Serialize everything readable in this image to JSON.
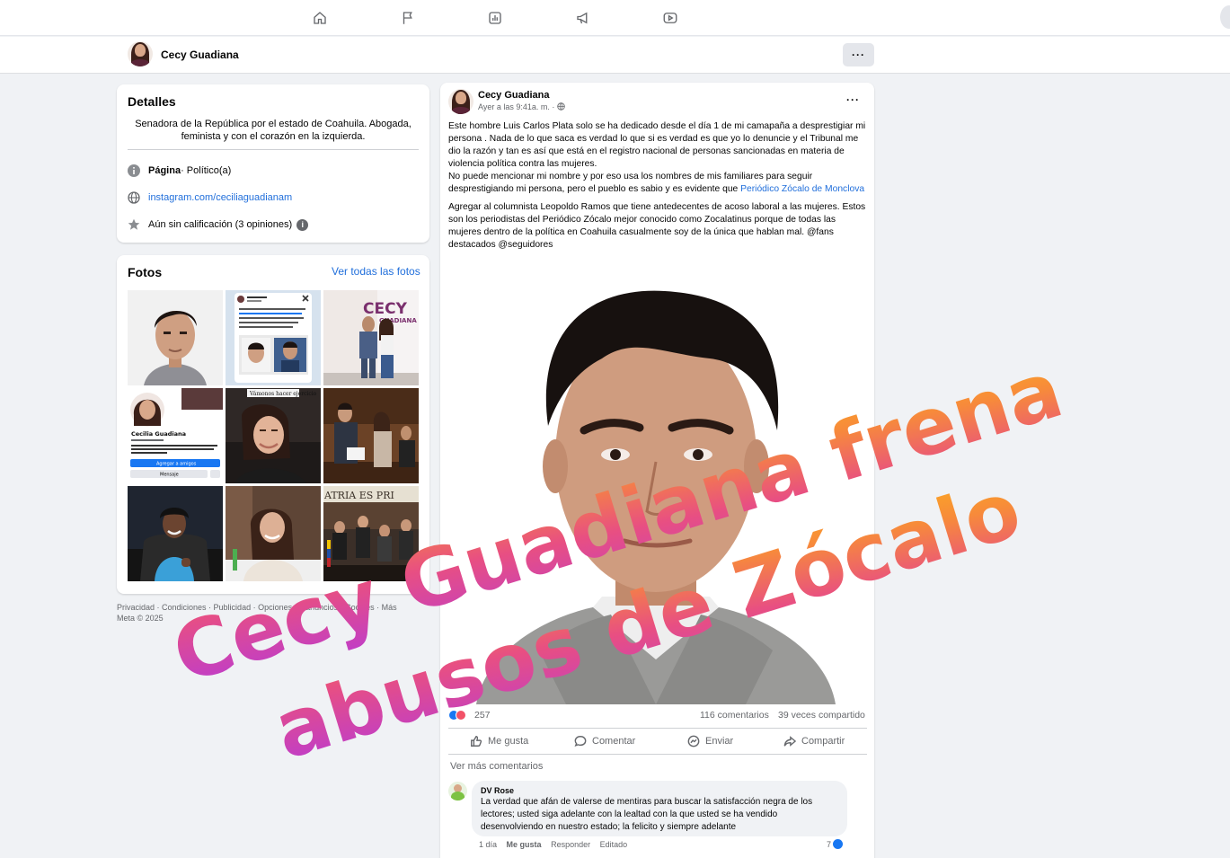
{
  "profile": {
    "name": "Cecy Guadiana",
    "more_label": "···"
  },
  "details": {
    "title": "Detalles",
    "bio": "Senadora de la República por el estado de Coahuila. Abogada, feminista y con el corazón en la izquierda.",
    "page_label": "Página",
    "page_category": " · Político(a)",
    "website": "instagram.com/ceciliaguadianam",
    "rating": "Aún sin calificación (3 opiniones)",
    "info_glyph": "i"
  },
  "photos": {
    "title": "Fotos",
    "see_all": "Ver todas las fotos",
    "tile_texts": {
      "profile_name": "Cecilia Guadiana",
      "add_friends": "Agregar a amigos",
      "message": "Mensaje",
      "caption": "Vámonos hacer ejercicio",
      "brand": "CECY",
      "brand_sub": "GUADIANA",
      "senate_banner": "ATRIA ES PRI"
    }
  },
  "footer": {
    "line1": "Privacidad · Condiciones · Publicidad · Opciones de anuncios · Cookies · Más",
    "line2": "Meta © 2025"
  },
  "post": {
    "author": "Cecy Guadiana",
    "time": "Ayer a las 9:41a. m. ·",
    "menu": "···",
    "p1_text": "Este hombre Luis Carlos Plata solo se ha dedicado desde el día 1 de mi camapaña a desprestigiar mi persona . Nada de lo que saca es verdad lo que si es verdad es que yo lo denuncie y el Tribunal me dio la razón y tan es así que está en el registro nacional de personas sancionadas en materia de violencia política contra las mujeres.",
    "p2_text": "No puede mencionar mi nombre y por eso usa los nombres de mis familiares para seguir desprestigiando mi persona, pero el pueblo es sabio y es evidente que ",
    "p2_link": "Periódico Zócalo de Monclova",
    "p3_text": "Agregar al columnista Leopoldo Ramos que tiene antedecentes de acoso laboral a las mujeres. Estos son los periodistas del Periódico Zócalo mejor conocido como Zocalatinus porque de todas las mujeres dentro de la política en Coahuila casualmente soy de la única que hablan mal. @fans destacados @seguidores",
    "reactions": "257",
    "comments_count": "116 comentarios",
    "shares_count": "39 veces compartido",
    "actions": [
      "Me gusta",
      "Comentar",
      "Enviar",
      "Compartir"
    ],
    "more_comments": "Ver más comentarios"
  },
  "comment": {
    "author": "DV Rose",
    "text": "La verdad que afán de valerse de mentiras para buscar la satisfacción negra de los lectores; usted siga adelante con la lealtad con la que usted se ha vendido desenvolviendo en nuestro estado; la felicito y siempre adelante",
    "time": "1 día",
    "like": "Me gusta",
    "reply": "Responder",
    "edited": "Editado",
    "likes": "7"
  },
  "overlay": {
    "line1": "Cecy Guadiana frena",
    "line2": "abusos de Zócalo",
    "gradient": [
      "#b83ad6",
      "#e84f82",
      "#f78a3b",
      "#fcae1e"
    ]
  },
  "colors": {
    "link": "#216fdb",
    "bg": "#f0f2f5",
    "text": "#050505",
    "muted": "#65676b"
  }
}
